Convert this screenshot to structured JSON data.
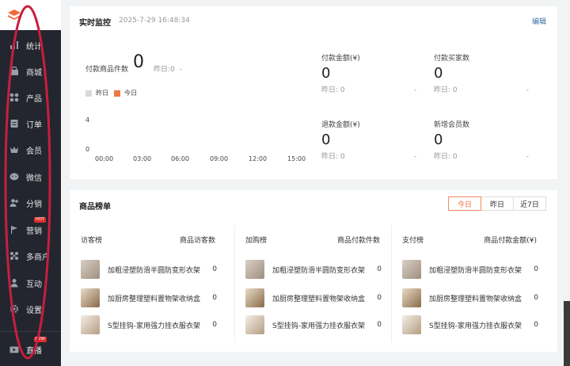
{
  "logo": {
    "text": "有赞",
    "accent": "#f06a3a"
  },
  "sidebar": {
    "items": [
      {
        "label": "统计",
        "icon": "bar-chart-icon"
      },
      {
        "label": "商城",
        "icon": "store-icon"
      },
      {
        "label": "产品",
        "icon": "grid-icon"
      },
      {
        "label": "订单",
        "icon": "order-icon"
      },
      {
        "label": "会员",
        "icon": "crown-icon"
      },
      {
        "label": "微信",
        "icon": "wechat-icon"
      },
      {
        "label": "分销",
        "icon": "users-icon"
      },
      {
        "label": "营销",
        "icon": "flag-icon",
        "badge": "HOT"
      },
      {
        "label": "多商户",
        "icon": "merchant-icon"
      },
      {
        "label": "互动",
        "icon": "interaction-icon"
      },
      {
        "label": "设置",
        "icon": "gear-icon"
      }
    ],
    "live": {
      "label": "直播",
      "icon": "tv-icon",
      "badge": "NEW"
    }
  },
  "monitor": {
    "title": "实时监控",
    "time": "2025-7-29 16:48:34",
    "edit": "编辑",
    "paid_items": {
      "label": "付款商品件数",
      "value": "0",
      "yesterday": "昨日:0",
      "dash": "-"
    },
    "legend": {
      "yesterday": "昨日",
      "today": "今日",
      "yesterday_color": "#d9d9d9",
      "today_color": "#f07845"
    },
    "chart_data": {
      "type": "line",
      "x": [
        "00:00",
        "03:00",
        "06:00",
        "09:00",
        "12:00",
        "15:00"
      ],
      "y_ticks": [
        "4",
        "0"
      ],
      "series": []
    },
    "metrics": [
      {
        "label": "付款金额(¥)",
        "value": "0",
        "yesterday": "昨日: 0",
        "dash": "-"
      },
      {
        "label": "付款买家数",
        "value": "0",
        "yesterday": "昨日: 0",
        "dash": "-"
      },
      {
        "label": "退款金额(¥)",
        "value": "0",
        "yesterday": "昨日: 0",
        "dash": "-"
      },
      {
        "label": "新增会员数",
        "value": "0",
        "yesterday": "昨日: 0",
        "dash": "-"
      }
    ]
  },
  "ranking": {
    "title": "商品榜单",
    "tabs": [
      "今日",
      "昨日",
      "近7日"
    ],
    "active_tab": "今日",
    "columns": [
      {
        "header": "访客榜",
        "metric": "商品访客数",
        "rows": [
          {
            "name": "加粗浸塑防滑半圆防变形衣架",
            "value": "0"
          },
          {
            "name": "加厨房整理塑料置物架收纳盒",
            "value": "0"
          },
          {
            "name": "S型挂钩-家用强力挂衣服衣架",
            "value": "0"
          }
        ]
      },
      {
        "header": "加购榜",
        "metric": "商品付款件数",
        "rows": [
          {
            "name": "加粗浸塑防滑半圆防变形衣架",
            "value": "0"
          },
          {
            "name": "加厨房整理塑料置物架收纳盒",
            "value": "0"
          },
          {
            "name": "S型挂钩-家用强力挂衣服衣架",
            "value": "0"
          }
        ]
      },
      {
        "header": "支付榜",
        "metric": "商品付款金额(¥)",
        "rows": [
          {
            "name": "加粗浸塑防滑半圆防变形衣架",
            "value": "0"
          },
          {
            "name": "加厨房整理塑料置物架收纳盒",
            "value": "0"
          },
          {
            "name": "S型挂钩-家用强力挂衣服衣架",
            "value": "0"
          }
        ]
      }
    ]
  }
}
